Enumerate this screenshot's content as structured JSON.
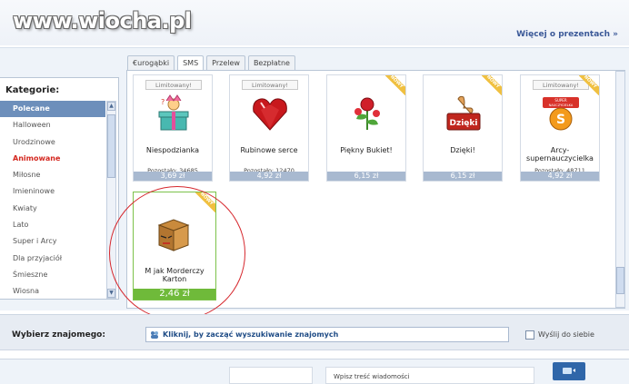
{
  "watermark": {
    "text": "www.wiocha.pl"
  },
  "header": {
    "more_link": "Więcej o prezentach »"
  },
  "tabs": [
    {
      "label": "€urogąbki",
      "active": false
    },
    {
      "label": "SMS",
      "active": true
    },
    {
      "label": "Przelew",
      "active": false
    },
    {
      "label": "Bezpłatne",
      "active": false
    }
  ],
  "sidebar": {
    "title": "Kategorie:",
    "items": [
      {
        "label": "Polecane",
        "state": "selected"
      },
      {
        "label": "Halloween",
        "state": ""
      },
      {
        "label": "Urodzinowe",
        "state": ""
      },
      {
        "label": "Animowane",
        "state": "highlight"
      },
      {
        "label": "Miłosne",
        "state": ""
      },
      {
        "label": "Imieninowe",
        "state": ""
      },
      {
        "label": "Kwiaty",
        "state": ""
      },
      {
        "label": "Lato",
        "state": ""
      },
      {
        "label": "Super i Arcy",
        "state": ""
      },
      {
        "label": "Dla przyjaciół",
        "state": ""
      },
      {
        "label": "Śmieszne",
        "state": ""
      },
      {
        "label": "Wiosna",
        "state": ""
      }
    ]
  },
  "gifts": [
    {
      "name": "Niespodzianka",
      "badge": "Limitowany!",
      "remaining": "Pozostało: 34685",
      "price": "3,69 zł",
      "new": false,
      "icon": "surprise-box-icon"
    },
    {
      "name": "Rubinowe serce",
      "badge": "Limitowany!",
      "remaining": "Pozostało: 12470",
      "price": "4,92 zł",
      "new": false,
      "icon": "ruby-heart-icon"
    },
    {
      "name": "Piękny Bukiet!",
      "badge": "",
      "remaining": "",
      "price": "6,15 zł",
      "new": true,
      "icon": "rose-bouquet-icon"
    },
    {
      "name": "Dzięki!",
      "badge": "",
      "remaining": "",
      "price": "6,15 zł",
      "new": true,
      "icon": "thumbs-up-icon"
    },
    {
      "name": "Arcy-supernauczycielka",
      "badge": "Limitowany!",
      "remaining": "Pozostało: 48711",
      "price": "4,92 zł",
      "new": true,
      "icon": "teacher-badge-icon"
    },
    {
      "name": "M jak Morderczy Karton",
      "badge": "",
      "remaining": "",
      "price": "2,46 zł",
      "new": true,
      "icon": "angry-box-icon"
    }
  ],
  "new_ribbon": "NOWY",
  "dzieki_sign": "Dzięki",
  "teacher_badge": {
    "top": "SUPER",
    "middle": "NAUCZYCIELKA",
    "letter": "S"
  },
  "friend": {
    "label": "Wybierz znajomego:",
    "search_text": "Kliknij, by zacząć wyszukiwanie znajomych",
    "self_label": "Wyślij do siebie"
  },
  "bottom": {
    "message_hint": "Wpisz treść wiadomości"
  },
  "colors": {
    "selected_category": "#6d8fbb",
    "price_bar": "#a8b9d0",
    "selected_price": "#6fba3a",
    "circle": "#d6282e"
  }
}
